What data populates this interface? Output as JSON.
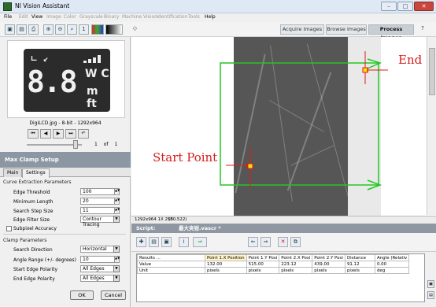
{
  "app": {
    "title": "NI Vision Assistant"
  },
  "menu": [
    "File",
    "Edit",
    "View",
    "Image",
    "Color",
    "Grayscale",
    "Binary",
    "Machine Vision",
    "Identification",
    "Tools",
    "Help"
  ],
  "mode_tabs": {
    "acquire": "Acquire Images",
    "browse": "Browse Images",
    "process": "Process Images"
  },
  "thumbnail": {
    "lcd": {
      "top_symbols": "ㄴ ↙",
      "digits": "8.8",
      "unit_top": "W C",
      "unit_bottom": "m ft"
    },
    "caption": "DigiLCD.jpg - 8-bit - 1292x964",
    "page": "1",
    "of_label": "of",
    "total": "1",
    "nav": [
      "⏮",
      "◀",
      "▶",
      "⏭",
      "↶"
    ]
  },
  "setup": {
    "title": "Max Clamp Setup",
    "tabs": [
      "Main",
      "Settings"
    ],
    "curve_group": "Curve Extraction Parameters",
    "edge_threshold": {
      "label": "Edge Threshold",
      "value": "100"
    },
    "min_length": {
      "label": "Minimum Length",
      "value": "20"
    },
    "search_step": {
      "label": "Search Step Size",
      "value": "11"
    },
    "edge_filter": {
      "label": "Edge Filter Size",
      "value": "Contour Tracing"
    },
    "subpixel": {
      "label": "Subpixel Accuracy"
    },
    "clamp_group": "Clamp Parameters",
    "search_dir": {
      "label": "Search Direction",
      "value": "Horizontal"
    },
    "angle_range": {
      "label": "Angle Range (+/- degrees)",
      "value": "10"
    },
    "start_edge": {
      "label": "Start Edge Polarity",
      "value": "All Edges"
    },
    "end_edge": {
      "label": "End Edge Polarity",
      "value": "All Edges"
    },
    "ok": "OK",
    "cancel": "Cancel"
  },
  "annotations": {
    "start": "Start Point",
    "end": "End"
  },
  "status": {
    "size": "1292x964 1X 255",
    "coords": "(80,522)"
  },
  "script": {
    "label": "Script:",
    "name": "最大夹钳.vascr *"
  },
  "results": {
    "headers": [
      "Results ...",
      "Point 1.X Position",
      "Point 1.Y Posi",
      "Point 2.X Posi",
      "Point 2.Y Posi",
      "Distance",
      "Angle (Relativ"
    ],
    "rows": [
      [
        "Value",
        "132.00",
        "515.00",
        "223.12",
        "439.00",
        "91.12",
        "0.00"
      ],
      [
        "Unit",
        "pixels",
        "pixels",
        "pixels",
        "pixels",
        "pixels",
        "deg"
      ]
    ]
  },
  "colors": {
    "overlay_green": "#22c722",
    "marker_red": "#e01b1b",
    "marker_yellow": "#f5e400",
    "panel_header": "#8c97a3"
  }
}
